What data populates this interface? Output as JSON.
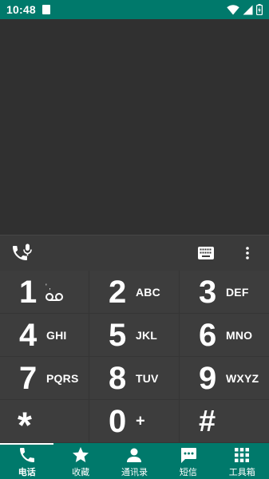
{
  "status_bar": {
    "time": "10:48"
  },
  "actions": {
    "wifi_call_icon": "phone-wifi-icon",
    "keyboard_icon": "keyboard-icon",
    "more_icon": "more-vert-icon"
  },
  "keypad": {
    "keys": [
      {
        "digit": "1",
        "letters": ""
      },
      {
        "digit": "2",
        "letters": "ABC"
      },
      {
        "digit": "3",
        "letters": "DEF"
      },
      {
        "digit": "4",
        "letters": "GHI"
      },
      {
        "digit": "5",
        "letters": "JKL"
      },
      {
        "digit": "6",
        "letters": "MNO"
      },
      {
        "digit": "7",
        "letters": "PQRS"
      },
      {
        "digit": "8",
        "letters": "TUV"
      },
      {
        "digit": "9",
        "letters": "WXYZ"
      },
      {
        "digit": "*",
        "letters": ""
      },
      {
        "digit": "0",
        "letters": "+"
      },
      {
        "digit": "#",
        "letters": ""
      }
    ]
  },
  "nav": {
    "items": [
      {
        "label": "电话",
        "icon": "phone-icon"
      },
      {
        "label": "收藏",
        "icon": "star-icon"
      },
      {
        "label": "通讯录",
        "icon": "person-icon"
      },
      {
        "label": "短信",
        "icon": "sms-icon"
      },
      {
        "label": "工具箱",
        "icon": "grid-icon"
      }
    ],
    "active": "电话"
  },
  "colors": {
    "status_bar": "#00796b",
    "nav_bar": "#00796b",
    "keypad_bg": "#3c3c3c",
    "display_bg": "#303030"
  }
}
